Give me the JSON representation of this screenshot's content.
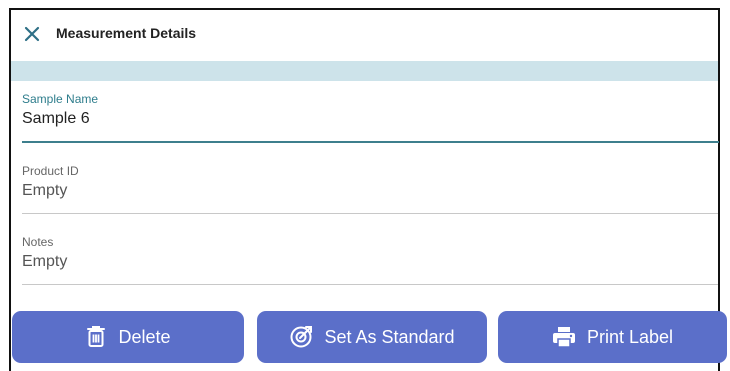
{
  "header": {
    "title": "Measurement Details",
    "close_icon": "close-icon"
  },
  "colors": {
    "accent": "#5b6fc9",
    "band": "#cde3ea",
    "focus": "#3d7f8d"
  },
  "fields": [
    {
      "label": "Sample Name",
      "value": "Sample 6",
      "focused": true
    },
    {
      "label": "Product ID",
      "value": "Empty",
      "focused": false
    },
    {
      "label": "Notes",
      "value": "Empty",
      "focused": false
    }
  ],
  "actions": [
    {
      "label": "Delete",
      "icon": "trash-icon"
    },
    {
      "label": "Set As Standard",
      "icon": "target-check-icon"
    },
    {
      "label": "Print Label",
      "icon": "printer-icon"
    }
  ]
}
